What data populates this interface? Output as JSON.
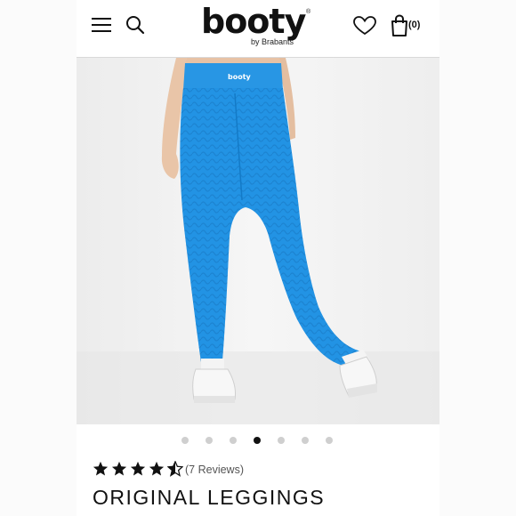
{
  "header": {
    "brand_name": "booty",
    "brand_sub": "by Brabants",
    "brand_mark": "®",
    "cart_count": "(0)",
    "icons": [
      "menu-icon",
      "search-icon",
      "heart-icon",
      "bag-icon"
    ]
  },
  "gallery": {
    "dot_count": 7,
    "active_index": 3
  },
  "product": {
    "rating": 4.5,
    "max_rating": 5,
    "reviews_label": "(7 Reviews)",
    "title": "ORIGINAL LEGGINGS",
    "legging_color": "#1d8ddc",
    "waistband_logo": "booty"
  }
}
